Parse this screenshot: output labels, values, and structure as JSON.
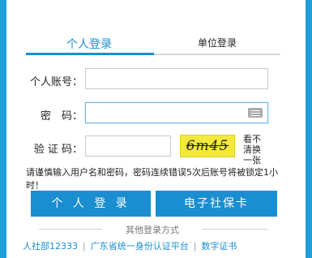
{
  "tabs": [
    {
      "label": "个人登录",
      "active": true
    },
    {
      "label": "单位登录",
      "active": false
    }
  ],
  "form": {
    "account_label": "个人账号：",
    "account_value": "",
    "password_label": "密　码：",
    "password_value": "",
    "captcha_label": "验 证 码：",
    "captcha_value": "",
    "captcha_text": "6m45",
    "captcha_refresh": "看不清换一张"
  },
  "notice": "请谨慎输入用户名和密码，密码连续错误5次后账号将被锁定1小时！",
  "buttons": {
    "personal_login": "个 人 登 录",
    "social_card": "电子社保卡"
  },
  "other_login": {
    "title": "其他登录方式",
    "links": [
      "人社部12333",
      "广东省统一身份认证平台",
      "数字证书"
    ]
  },
  "colors": {
    "accent": "#1a8ed0",
    "background": "#1f9fd8",
    "captcha_bg": "#f3e93a"
  }
}
